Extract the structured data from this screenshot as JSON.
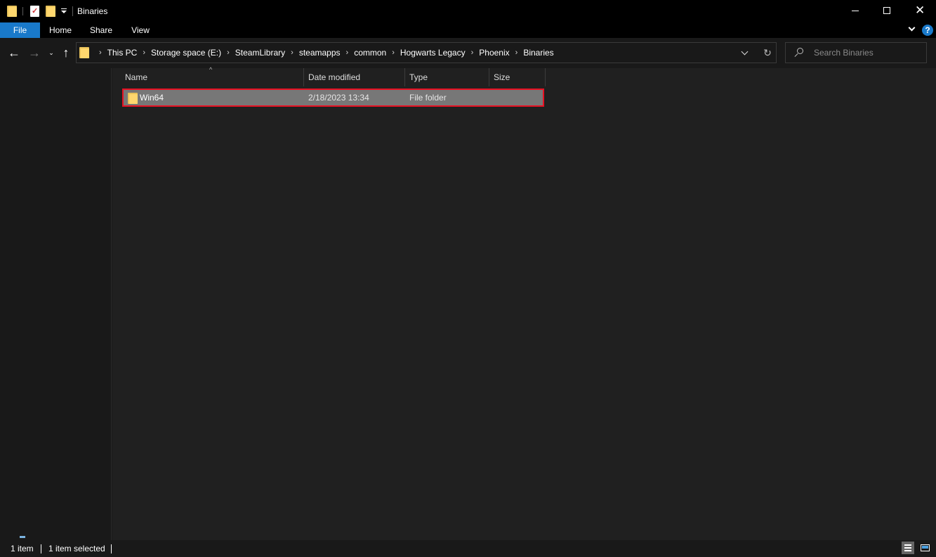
{
  "window": {
    "title": "Binaries"
  },
  "ribbon": {
    "tabs": [
      "File",
      "Home",
      "Share",
      "View"
    ]
  },
  "navigation": {
    "back_label": "←",
    "forward_label": "→",
    "recent_label": "⌄",
    "up_label": "↑"
  },
  "address": {
    "breadcrumbs": [
      "This PC",
      "Storage space (E:)",
      "SteamLibrary",
      "steamapps",
      "common",
      "Hogwarts Legacy",
      "Phoenix",
      "Binaries"
    ],
    "separator": "›"
  },
  "search": {
    "placeholder": "Search Binaries"
  },
  "file_list": {
    "columns": [
      "Name",
      "Date modified",
      "Type",
      "Size"
    ],
    "sort_indicator": "^",
    "rows": [
      {
        "name": "Win64",
        "date_modified": "2/18/2023 13:34",
        "type": "File folder",
        "size": "",
        "selected": true
      }
    ]
  },
  "status_bar": {
    "item_count": "1 item",
    "selection": "1 item selected"
  },
  "colors": {
    "accent": "#1979ca",
    "selection_outline": "#e81123",
    "selected_row": "#777777",
    "background": "#202020"
  }
}
